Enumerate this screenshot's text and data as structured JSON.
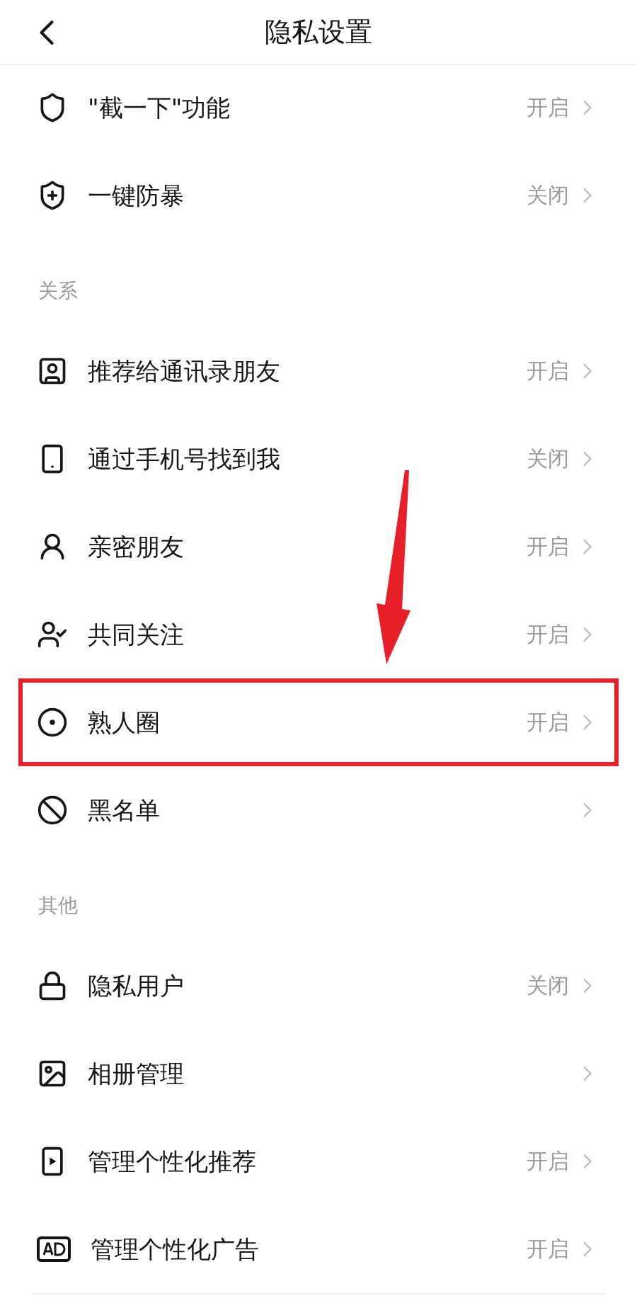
{
  "header": {
    "title": "隐私设置"
  },
  "sections": [
    {
      "items": [
        {
          "label": "\"截一下\"功能",
          "value": "开启",
          "highlighted": false
        },
        {
          "label": "一键防暴",
          "value": "关闭",
          "highlighted": false
        }
      ]
    },
    {
      "title": "关系",
      "items": [
        {
          "label": "推荐给通讯录朋友",
          "value": "开启",
          "highlighted": false
        },
        {
          "label": "通过手机号找到我",
          "value": "关闭",
          "highlighted": false
        },
        {
          "label": "亲密朋友",
          "value": "开启",
          "highlighted": false
        },
        {
          "label": "共同关注",
          "value": "开启",
          "highlighted": false
        },
        {
          "label": "熟人圈",
          "value": "开启",
          "highlighted": true
        },
        {
          "label": "黑名单",
          "highlighted": false
        }
      ]
    },
    {
      "title": "其他",
      "items": [
        {
          "label": "隐私用户",
          "value": "关闭",
          "highlighted": false
        },
        {
          "label": "相册管理",
          "highlighted": false
        },
        {
          "label": "管理个性化推荐",
          "value": "开启",
          "highlighted": false
        },
        {
          "label": "管理个性化广告",
          "value": "开启",
          "highlighted": false
        }
      ]
    }
  ]
}
